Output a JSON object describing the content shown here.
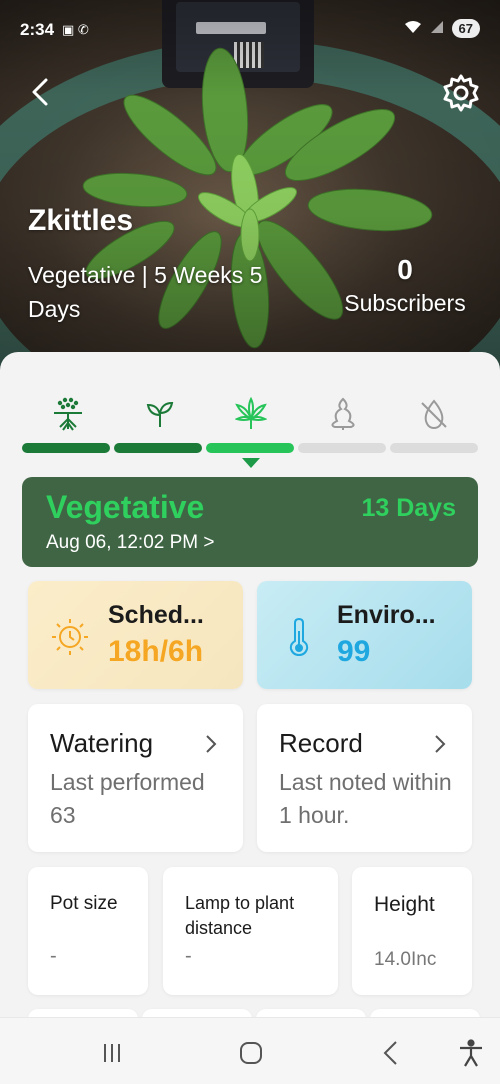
{
  "status_bar": {
    "time": "2:34",
    "battery": "67"
  },
  "header": {
    "plant_name": "Zkittles",
    "stage_summary": "Vegetative | 5 Weeks 5 Days",
    "subscribers_count": "0",
    "subscribers_label": "Subscribers"
  },
  "stages": {
    "icons": [
      "germination-icon",
      "seedling-icon",
      "vegetative-leaf-icon",
      "flowering-icon",
      "drying-icon"
    ],
    "completed": 2,
    "current_index": 2
  },
  "current_stage": {
    "name": "Vegetative",
    "days": "13 Days",
    "date": "Aug 06, 12:02 PM >"
  },
  "schedule": {
    "label": "Sched...",
    "value": "18h/6h"
  },
  "environment": {
    "label": "Enviro...",
    "value": "99"
  },
  "watering": {
    "title": "Watering",
    "body": "Last performed 63"
  },
  "record": {
    "title": "Record",
    "body": "Last noted within 1 hour."
  },
  "pot_size": {
    "label": "Pot size",
    "value": "-"
  },
  "lamp_distance": {
    "label": "Lamp to plant distance",
    "value": "-"
  },
  "height": {
    "label": "Height",
    "value": "14.0Inc"
  },
  "colors": {
    "accent_green": "#2fd05e",
    "stage_card_bg": "#3f6544",
    "progress_done": "#1c7a38",
    "schedule_value": "#f5a623",
    "enviro_value": "#1fa8e0"
  }
}
